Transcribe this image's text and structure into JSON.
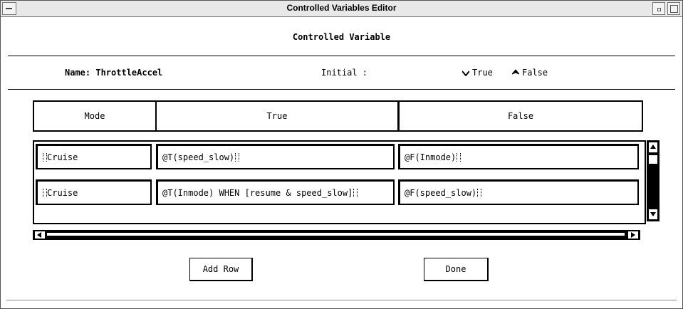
{
  "window": {
    "title": "Controlled Variables Editor"
  },
  "header": {
    "title": "Controlled Variable"
  },
  "info": {
    "name_label": "Name: ThrottleAccel",
    "initial_label": "Initial :",
    "options": [
      {
        "label": "True",
        "selected": false
      },
      {
        "label": "False",
        "selected": true
      }
    ]
  },
  "table": {
    "columns": [
      "Mode",
      "True",
      "False"
    ],
    "rows": [
      {
        "mode": "Cruise",
        "true_cond": "@T(speed_slow)",
        "false_cond": "@F(Inmode)"
      },
      {
        "mode": "Cruise",
        "true_cond": "@T(Inmode) WHEN [resume & speed_slow]",
        "false_cond": "@F(speed_slow)"
      }
    ]
  },
  "buttons": {
    "add_row": "Add Row",
    "done": "Done"
  },
  "icons": {
    "radio_unselected": "diamond-open-icon",
    "radio_selected": "diamond-filled-icon"
  }
}
